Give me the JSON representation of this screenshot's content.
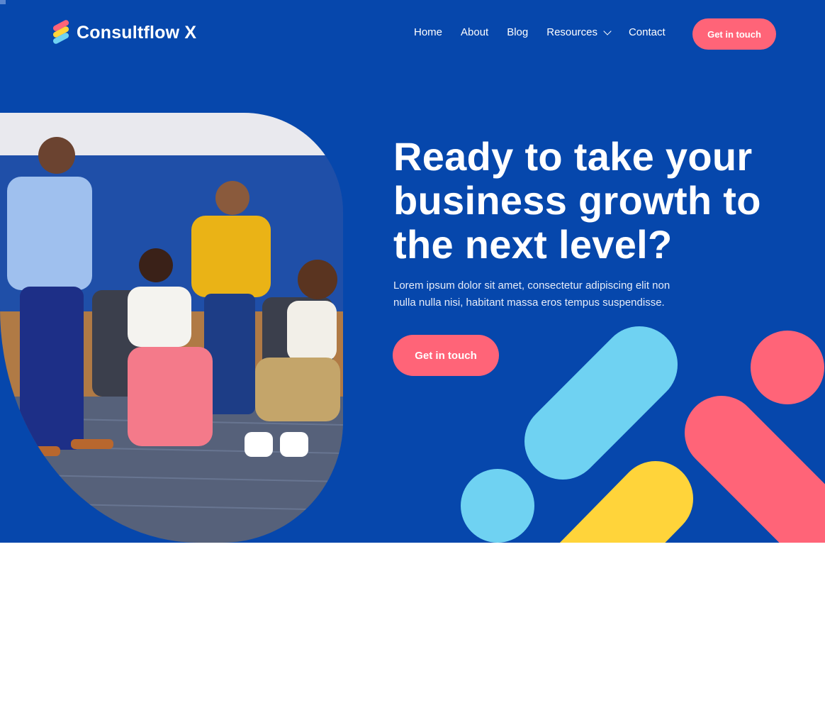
{
  "brand": {
    "name": "Consultflow X"
  },
  "nav": {
    "items": [
      {
        "label": "Home"
      },
      {
        "label": "About"
      },
      {
        "label": "Blog"
      },
      {
        "label": "Resources"
      },
      {
        "label": "Contact"
      }
    ],
    "cta_label": "Get in touch"
  },
  "hero": {
    "headline_lines": [
      "Ready to take your",
      "business growth to",
      "the next level?"
    ],
    "subtext_lines": [
      "Lorem ipsum dolor sit amet, consectetur adipiscing elit non",
      "nulla nulla nisi, habitant massa eros tempus suspendisse."
    ],
    "cta_label": "Get in touch"
  },
  "colors": {
    "hero_bg": "#0647AC",
    "accent_pink": "#FF6478",
    "accent_blue": "#6FD2F2",
    "accent_yellow": "#FFD43A",
    "white": "#FFFFFF"
  },
  "icons": {
    "logo": "striped-logo-icon",
    "resources_dropdown": "chevron-down-icon"
  }
}
